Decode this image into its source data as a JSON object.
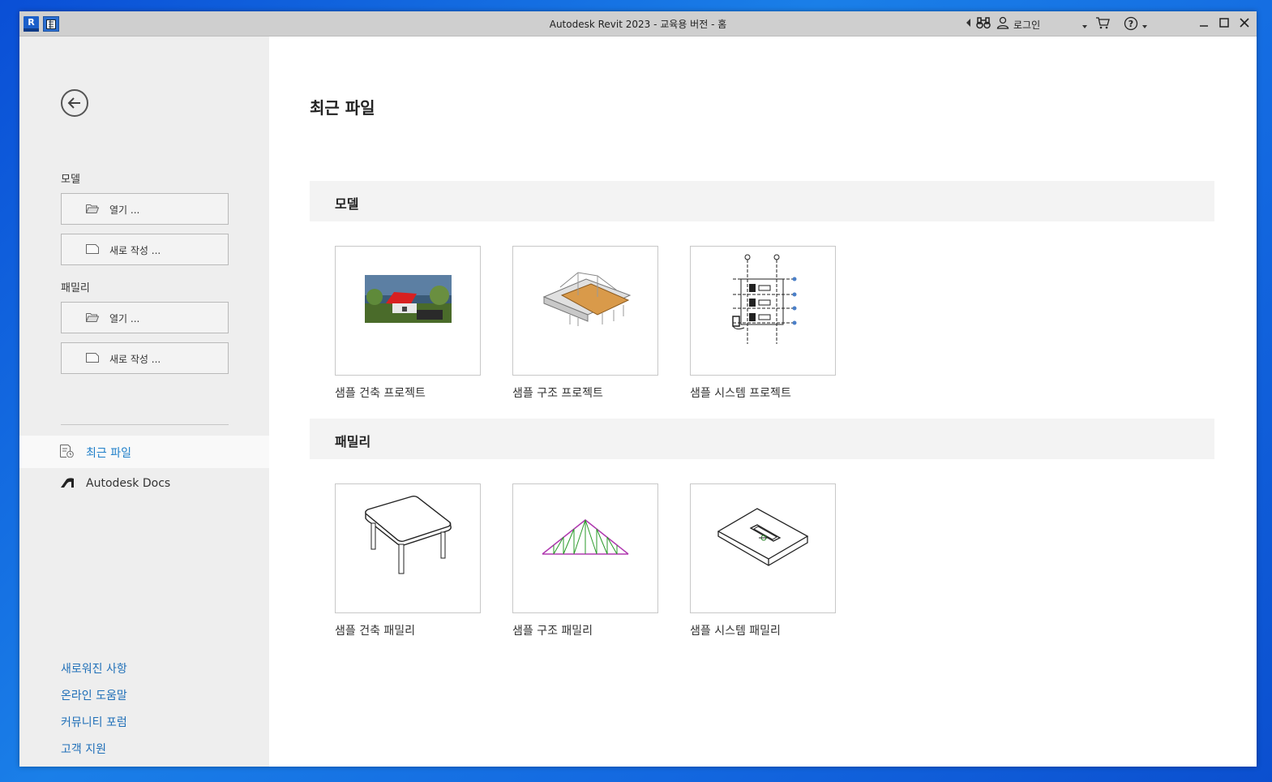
{
  "titlebar": {
    "title": "Autodesk Revit 2023 - 교육용 버전 - 홈",
    "app_logo": "R",
    "login_label": "로그인"
  },
  "sidebar": {
    "model_section": "모델",
    "model_open": "열기 ...",
    "model_new": "새로 작성 ...",
    "family_section": "패밀리",
    "family_open": "열기 ...",
    "family_new": "새로 작성 ...",
    "nav": {
      "recent": "최근 파일",
      "docs": "Autodesk Docs"
    },
    "links": {
      "whats_new": "새로워진 사항",
      "online_help": "온라인 도움말",
      "community": "커뮤니티 포럼",
      "support": "고객 지원"
    }
  },
  "main": {
    "title": "최근 파일",
    "models": {
      "heading": "모델",
      "items": [
        {
          "label": "샘플 건축 프로젝트",
          "icon": "architecture-project-thumbnail"
        },
        {
          "label": "샘플 구조 프로젝트",
          "icon": "structure-project-thumbnail"
        },
        {
          "label": "샘플 시스템 프로젝트",
          "icon": "systems-project-thumbnail"
        }
      ]
    },
    "families": {
      "heading": "패밀리",
      "items": [
        {
          "label": "샘플 건축 패밀리",
          "icon": "table-family-thumbnail"
        },
        {
          "label": "샘플 구조 패밀리",
          "icon": "truss-family-thumbnail"
        },
        {
          "label": "샘플 시스템 패밀리",
          "icon": "diffuser-family-thumbnail"
        }
      ]
    }
  },
  "colors": {
    "accent": "#1f7fc9",
    "link": "#1f6fb8",
    "sidebar_bg": "#eeeeee",
    "titlebar_bg": "#cfcfcf"
  }
}
